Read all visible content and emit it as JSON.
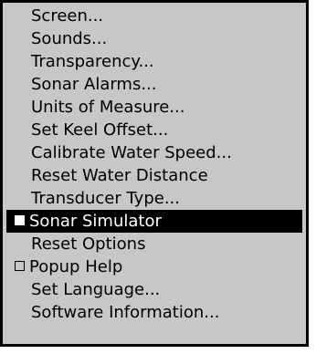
{
  "menu": {
    "items": [
      {
        "label": "Screen...",
        "checkbox": false
      },
      {
        "label": "Sounds...",
        "checkbox": false
      },
      {
        "label": "Transparency...",
        "checkbox": false
      },
      {
        "label": "Sonar Alarms...",
        "checkbox": false
      },
      {
        "label": "Units of Measure...",
        "checkbox": false
      },
      {
        "label": "Set Keel Offset...",
        "checkbox": false
      },
      {
        "label": "Calibrate Water Speed...",
        "checkbox": false
      },
      {
        "label": "Reset Water Distance",
        "checkbox": false
      },
      {
        "label": "Transducer Type...",
        "checkbox": false
      },
      {
        "label": "Sonar Simulator",
        "checkbox": true,
        "checked": true,
        "selected": true
      },
      {
        "label": "Reset Options",
        "checkbox": false
      },
      {
        "label": "Popup Help",
        "checkbox": true,
        "checked": false
      },
      {
        "label": "Set Language...",
        "checkbox": false
      },
      {
        "label": "Software Information...",
        "checkbox": false
      }
    ]
  },
  "colors": {
    "menu_background": "#c7c7c7",
    "highlight_background": "#000000",
    "highlight_text": "#ffffff",
    "border": "#000000"
  }
}
